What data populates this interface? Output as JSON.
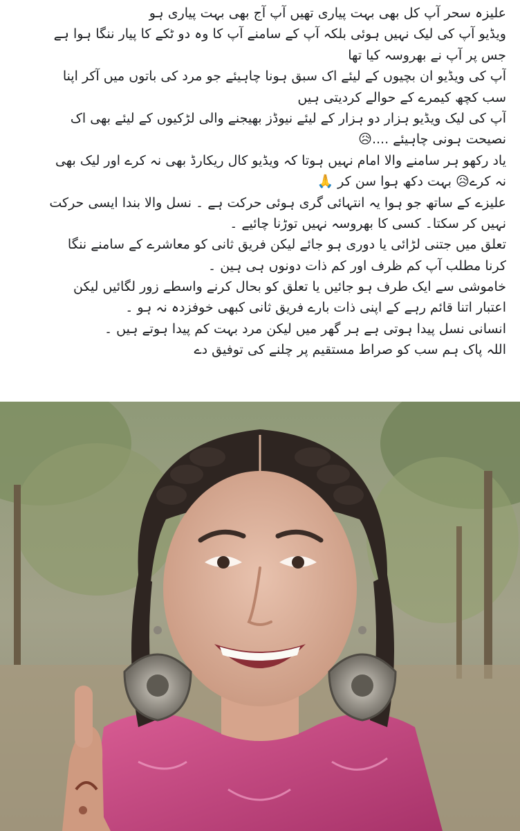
{
  "post": {
    "lines": [
      "علیزہ سحر آپ کل بھی بہت پیاری تھیں آپ آج بھی بہت پیاری ہو",
      "ویڈیو آپ کی لیک نہیں ہوئی بلکہ آپ کے سامنے آپ کا وہ دو ٹکے کا پیار ننگا ہوا ہے",
      "جس پر آپ نے بھروسہ کیا تھا",
      "آپ کی ویڈیو ان بچیوں کے لیئے اک سبق ہونا چاہیئے جو مرد کی باتوں میں آکر اپنا",
      "سب کچھ کیمرے کے حوالے کردیتی ہیں",
      "آپ کی لیک ویڈیو ہزار دو ہزار کے لیئے نیوڈز بھیجنے والی لڑکیوں کے لیئے بھی اک",
      "نصیحت ہونی چاہیئے ....😥",
      "یاد رکھو ہر سامنے والا امام نہیں ہوتا کہ ویڈیو کال ریکارڈ بھی نہ کرے اور لیک بھی",
      "نہ کرے😥 بہت دکھ ہوا  سن کر 🙏",
      "علیزے  کے ساتھ جو ہوا یہ انتہائی گری ہوئی حرکت ہے ۔ نسل والا بندا ایسی حرکت",
      "نہیں کر سکتا۔ کسی کا بھروسہ نہیں توڑنا چائیے ۔",
      "تعلق میں جتنی لڑائی یا دوری ہو جائے لیکن فریق ثانی کو معاشرے کے سامنے ننگا",
      "کرنا مطلب آپ کم ظرف اور کم ذات دونوں ہی ہین ۔",
      "خاموشی سے ایک طرف ہو جائیں یا تعلق کو بحال کرنے واسطے زور لگائیں لیکن",
      "اعتبار اتنا قائم رہے کے اپنی ذات بارے فریق ثانی کبھی خوفزدہ نہ ہو ۔",
      "انسانی نسل پیدا ہوتی ہے ہر گھر میں لیکن مرد بہت کم پیدا ہوتے ہیں ۔",
      "اللہ پاک ہم سب کو صراط مستقیم پر چلنے کی توفیق دے"
    ]
  },
  "photo": {
    "subject": "portrait of smiling woman with braided hair and large silver earrings, wearing pink dupatta, outdoors with trees"
  },
  "colors": {
    "text": "#1c1e21",
    "background": "#ffffff",
    "dupatta": "#c8477e",
    "foliage": "#7f8f63"
  }
}
